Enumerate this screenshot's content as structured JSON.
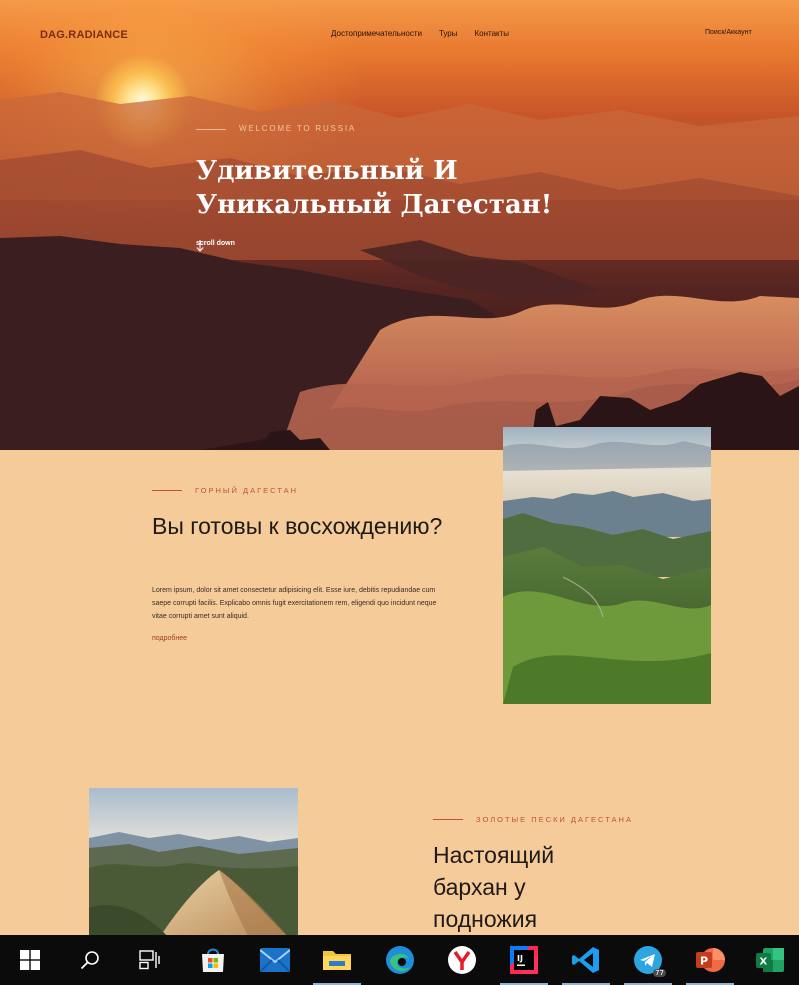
{
  "nav": {
    "logo": "DAG.RADIANCE",
    "links": [
      "Достопримечательности",
      "Туры",
      "Контакты"
    ],
    "account": "Поиск/Аккаунт"
  },
  "hero": {
    "kicker": "WELCOME TO RUSSIA",
    "title": "Удивительный И Уникальный Дагестан!",
    "scroll_label": "scroll down",
    "scroll_icon": "arrow-down-icon"
  },
  "section1": {
    "kicker": "ГОРНЫЙ ДАГЕСТАН",
    "title": "Вы готовы к восхождению?",
    "text": "Lorem ipsum, dolor sit amet consectetur adipisicing elit. Esse iure, debitis repudiandae cum saepe corrupti facilis. Explicabo omnis fugit exercitationem rem, eligendi quo incidunt neque vitae corrupti amet sunt aliquid.",
    "more": "подробнее"
  },
  "section2": {
    "kicker": "ЗОЛОТЫЕ ПЕСКИ ДАГЕСТАНА",
    "title": "Настоящий бархан у подножия"
  },
  "taskbar": {
    "icons": [
      "windows-start-icon",
      "search-icon",
      "task-view-icon",
      "microsoft-store-icon",
      "mail-icon",
      "file-explorer-icon",
      "edge-icon",
      "yandex-browser-icon",
      "intellij-idea-icon",
      "vscode-icon",
      "telegram-icon",
      "powerpoint-icon",
      "excel-icon"
    ],
    "telegram_badge": "77"
  },
  "colors": {
    "page_bg": "#f5cb99",
    "accent": "#c2532e",
    "logo": "#7a2d12",
    "taskbar": "#0b0b0c"
  }
}
